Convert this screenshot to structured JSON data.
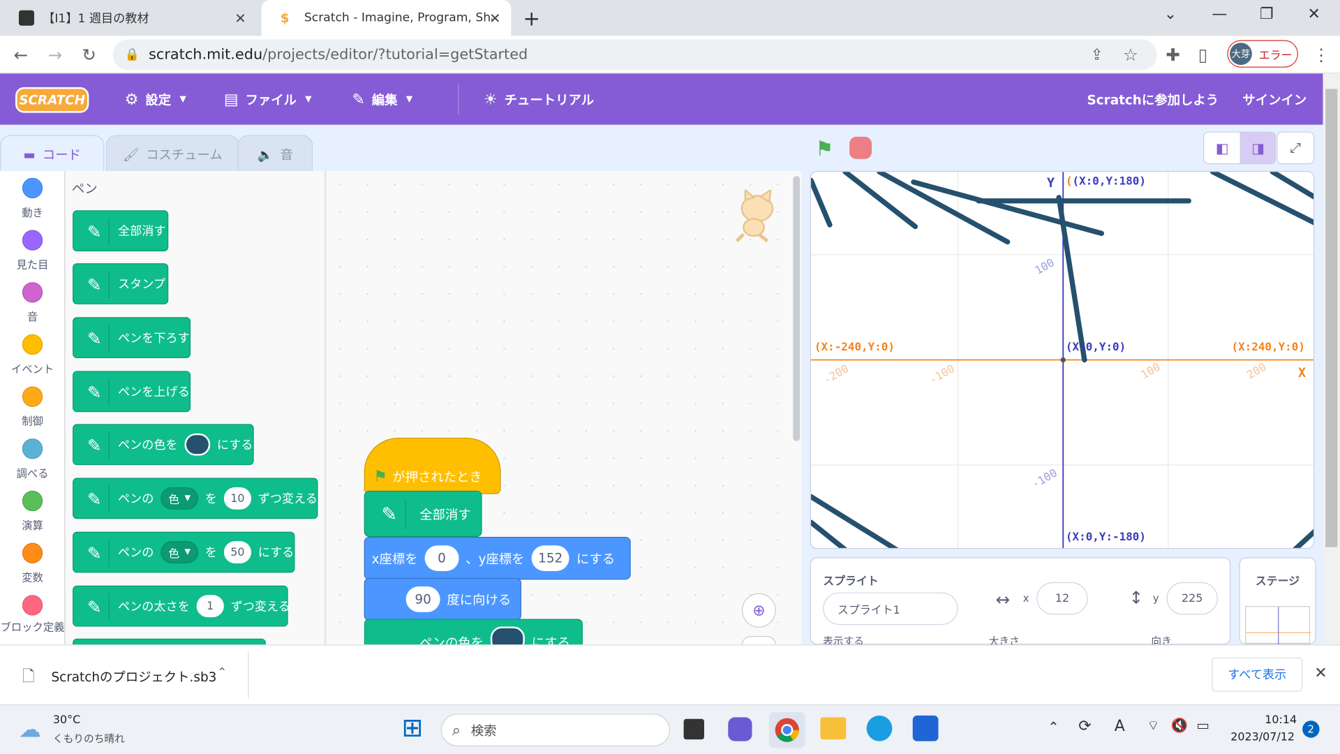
{
  "browser": {
    "tabs": [
      {
        "title": "【I1】1 週目の教材"
      },
      {
        "title": "Scratch - Imagine, Program, Shar"
      }
    ],
    "url_host": "scratch.mit.edu",
    "url_path": "/projects/editor/?tutorial=getStarted",
    "profile_initials": "大芽",
    "profile_status": "エラー"
  },
  "menubar": {
    "logo": "SCRATCH",
    "settings": "設定",
    "file": "ファイル",
    "edit": "編集",
    "tutorial": "チュートリアル",
    "join": "Scratchに参加しよう",
    "signin": "サインイン"
  },
  "editor_tabs": {
    "code": "コード",
    "costume": "コスチューム",
    "sound": "音"
  },
  "categories": [
    {
      "label": "動き",
      "color": "#4c97ff"
    },
    {
      "label": "見た目",
      "color": "#9966ff"
    },
    {
      "label": "音",
      "color": "#cf63cf"
    },
    {
      "label": "イベント",
      "color": "#ffbf00"
    },
    {
      "label": "制御",
      "color": "#ffab19"
    },
    {
      "label": "調べる",
      "color": "#5cb1d6"
    },
    {
      "label": "演算",
      "color": "#59c059"
    },
    {
      "label": "変数",
      "color": "#ff8c1a"
    },
    {
      "label": "ブロック定義",
      "color": "#ff6680"
    }
  ],
  "palette": {
    "heading": "ペン",
    "clear": "全部消す",
    "stamp": "スタンプ",
    "pen_down": "ペンを下ろす",
    "pen_up": "ペンを上げる",
    "set_color_pre": "ペンの色を",
    "set_color_post": "にする",
    "change_pre": "ペンの",
    "change_param": "色",
    "change_mid": "を",
    "change_value": "10",
    "change_post": "ずつ変える",
    "set_pre": "ペンの",
    "set_param": "色",
    "set_mid": "を",
    "set_value": "50",
    "set_post": "にする",
    "size_pre": "ペンの太さを",
    "size_value": "1",
    "size_post": "ずつ変える"
  },
  "script": {
    "hat": "が押されたとき",
    "clear": "全部消す",
    "goto_x_label": "x座標を",
    "goto_x": "0",
    "goto_y_label": "、y座標を",
    "goto_y": "152",
    "goto_post": "にする",
    "dir_value": "90",
    "dir_label": "度に向ける",
    "color_pre": "ペンの色を",
    "color_post": "にする"
  },
  "stage": {
    "y_axis": "Y",
    "x_axis": "X",
    "top": "(X:0,Y:180)",
    "bottom": "(X:0,Y:-180)",
    "left": "(X:-240,Y:0)",
    "center": "(X:0,Y:0)",
    "right": "(X:240,Y:0)",
    "tick_y_pos": "100",
    "tick_y_neg": "-100",
    "tick_x_m200": "-200",
    "tick_x_m100": "-100",
    "tick_x_p100": "100",
    "tick_x_p200": "200",
    "pen_color": "#25506e"
  },
  "sprite": {
    "label": "スプライト",
    "name": "スプライト1",
    "x_label": "x",
    "x": "12",
    "y_label": "y",
    "y": "225",
    "show_label": "表示する",
    "size_label": "大きさ",
    "direction_label": "向き",
    "stage_label": "ステージ"
  },
  "downloads": {
    "file": "Scratchのプロジェクト.sb3",
    "show_all": "すべて表示"
  },
  "taskbar": {
    "temp": "30°C",
    "weather": "くもりのち晴れ",
    "search": "検索",
    "time": "10:14",
    "date": "2023/07/12",
    "notif": "2"
  }
}
